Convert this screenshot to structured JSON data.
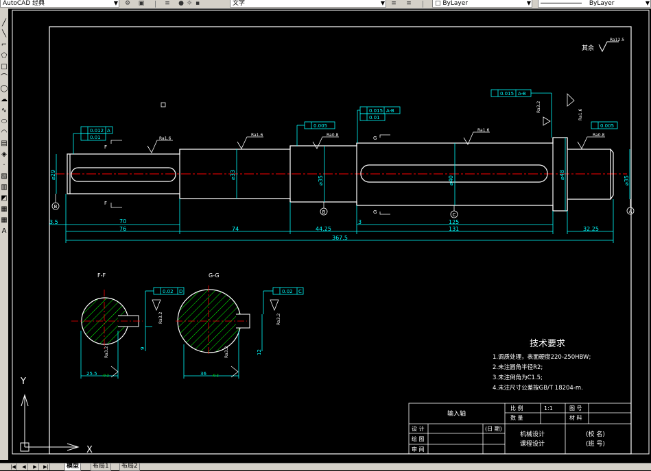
{
  "toolbar": {
    "workspace": "AutoCAD 经典",
    "text_style": "文字",
    "color": "ByLayer",
    "linetype": "ByLayer"
  },
  "tabs": [
    "模型",
    "布局1",
    "布局2"
  ],
  "drawing": {
    "roughness_note_label": "其余",
    "roughness_note_value": "Ra12.5",
    "ra16": "Ra1.6",
    "ra08": "Ra0.8",
    "ra32": "Ra3.2",
    "tol_012": "0.012",
    "tol_001": "0.01",
    "tol_005": "0.005",
    "tol_0015": "0.015",
    "tol_002": "0.02",
    "datum_A": "A",
    "datum_B": "B",
    "datum_C": "C",
    "datum_D": "D",
    "datum_AB": "A-B",
    "section_F": "F",
    "section_G": "G",
    "section_FF": "F-F",
    "section_GG": "G-G",
    "dim_35": "3.5",
    "dim_70": "70",
    "dim_76": "76",
    "dim_74": "74",
    "dim_4425": "44.25",
    "dim_3": "3",
    "dim_125": "125",
    "dim_131": "131",
    "dim_3225": "32.25",
    "dim_3675": "367.5",
    "dia_29": "⌀29",
    "dia_33": "⌀33",
    "dia_35a": "⌀35",
    "dia_40": "⌀40",
    "dia_48": "⌀48",
    "dia_35b": "⌀35",
    "sec_w1": "9",
    "sec_w2": "12",
    "sec_d1": "25.5",
    "sec_d2": "36",
    "sec_tol1": "-0.2",
    "sec_tol2": "-0.2",
    "tech_title": "技术要求",
    "tech_items": [
      "1.调质处理，表面硬度220-250HBW;",
      "2.未注圆角半径R2;",
      "3.未注倒角为C1.5;",
      "4.未注尺寸公差按GB/T 18204-m."
    ],
    "title_part": "输入轴",
    "title_scale_label": "比 例",
    "title_scale": "1:1",
    "title_drawno_label": "图 号",
    "title_qty_label": "数 量",
    "title_material_label": "材 料",
    "title_design": "设 计",
    "title_date": "(日 期)",
    "title_draw": "绘 图",
    "title_check": "审 阅",
    "title_course1": "机械设计",
    "title_course2": "课程设计",
    "title_school": "(校 名)",
    "title_class": "(班 号)"
  },
  "ucs": {
    "x": "X",
    "y": "Y"
  },
  "colors": {
    "outline": "#ffffff",
    "dimension": "#00ffff",
    "centerline": "#ff0000",
    "hatch": "#00ff00",
    "tolerance_text": "#00ff00"
  }
}
